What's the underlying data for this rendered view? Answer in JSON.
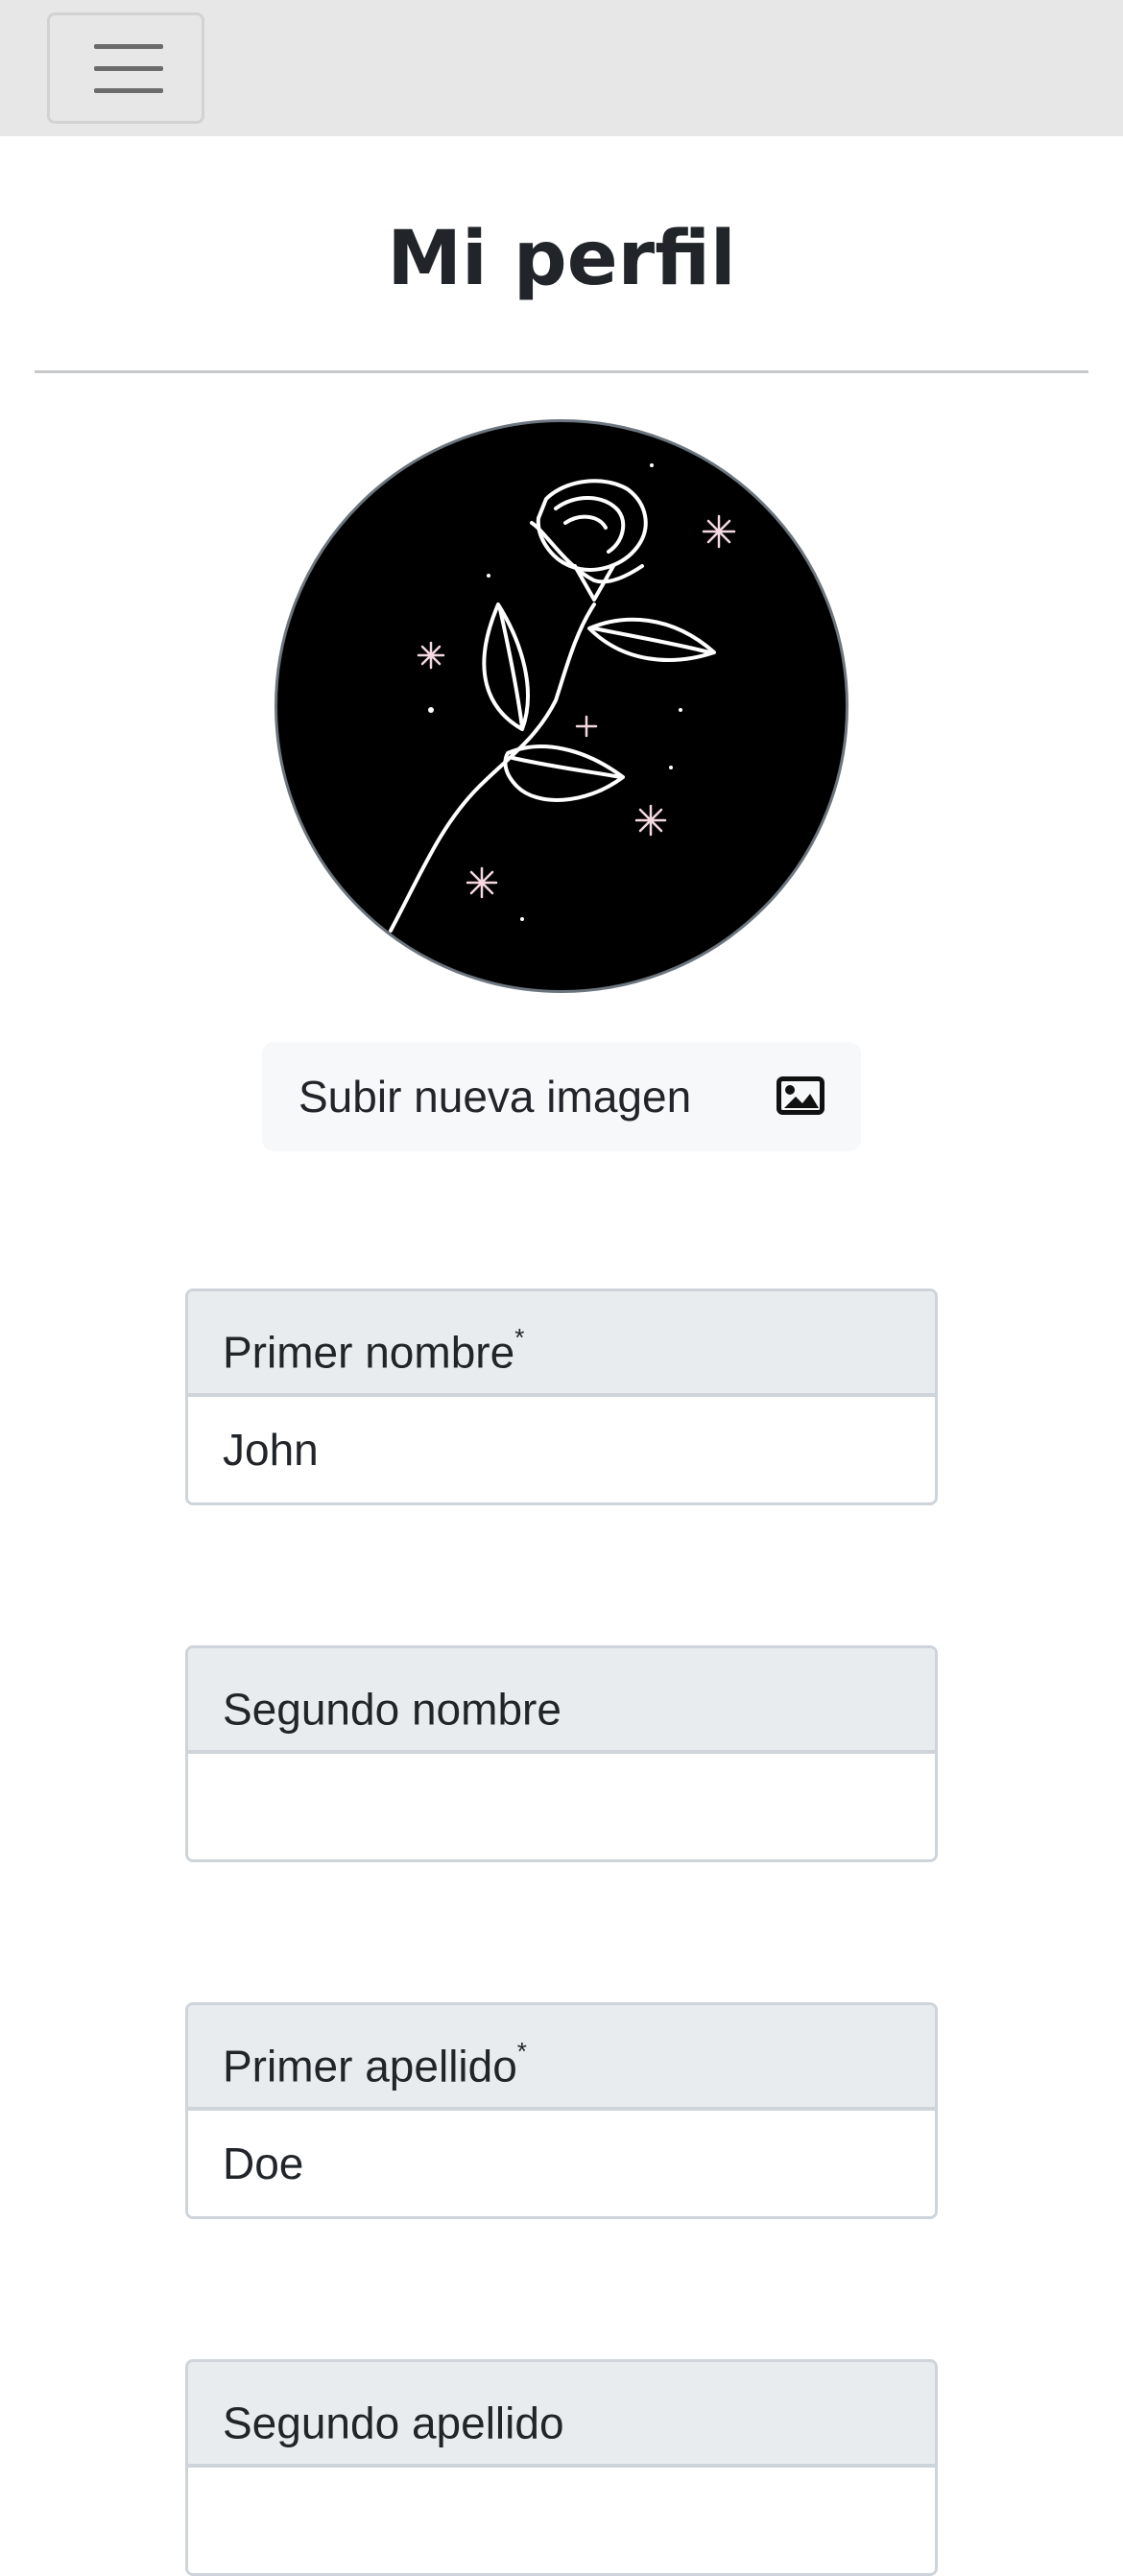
{
  "navbar": {
    "menu_icon": "hamburger-menu-icon"
  },
  "page": {
    "title": "Mi perfil"
  },
  "profile": {
    "avatar_alt": "rose-illustration",
    "upload_label": "Subir nueva imagen",
    "upload_icon": "image-icon"
  },
  "form": {
    "fields": [
      {
        "label": "Primer nombre",
        "required_mark": "*",
        "value": "John"
      },
      {
        "label": "Segundo nombre",
        "required_mark": "",
        "value": ""
      },
      {
        "label": "Primer apellido",
        "required_mark": "*",
        "value": "Doe"
      },
      {
        "label": "Segundo apellido",
        "required_mark": "",
        "value": ""
      }
    ]
  },
  "colors": {
    "navbar_bg": "#e7e7e7",
    "label_bg": "#e9ecef",
    "border": "#ced4da",
    "text": "#212529"
  }
}
